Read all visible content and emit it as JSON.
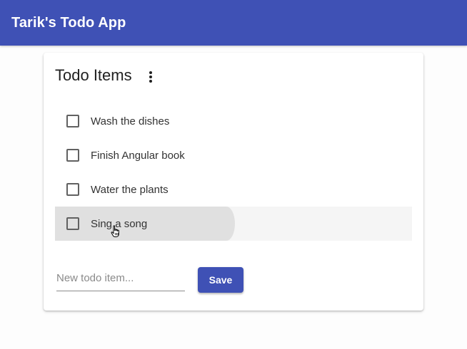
{
  "app": {
    "title": "Tarik's Todo App",
    "accent_color": "#3f51b5"
  },
  "card": {
    "title": "Todo Items",
    "menu_icon": "more-vert-icon"
  },
  "todos": [
    {
      "label": "Wash the dishes",
      "checked": false
    },
    {
      "label": "Finish Angular book",
      "checked": false
    },
    {
      "label": "Water the plants",
      "checked": false
    },
    {
      "label": "Sing a song",
      "checked": false,
      "hovered": true
    }
  ],
  "new_item": {
    "placeholder": "New todo item...",
    "value": ""
  },
  "save_button": {
    "label": "Save"
  }
}
